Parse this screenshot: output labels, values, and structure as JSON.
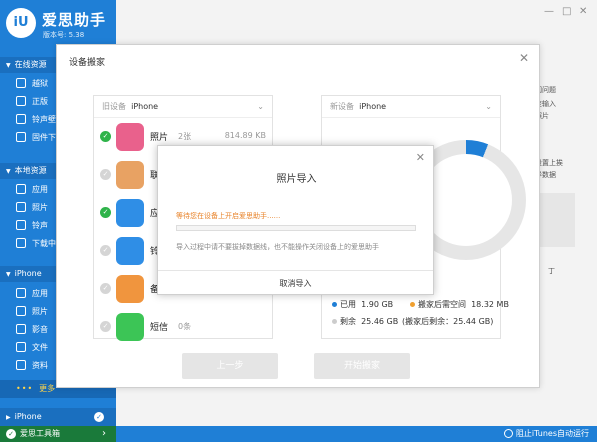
{
  "app": {
    "logo_text": "iU",
    "title": "爱思助手",
    "version": "版本号: 5.38"
  },
  "sidebar": {
    "online_header": "在线资源",
    "online_items": [
      "越狱",
      "正版",
      "铃声壁",
      "固件下"
    ],
    "local_header": "本地资源",
    "local_items": [
      "应用",
      "照片",
      "铃声",
      "下载中"
    ],
    "iphone_header": "iPhone",
    "iphone_items": [
      "应用",
      "照片",
      "影音",
      "文件",
      "资料"
    ],
    "more_label": "更多",
    "device2_label": "iPhone",
    "toolbox_label": "爱思工具箱"
  },
  "bottom_bar": {
    "itunes_label": "阻止iTunes自动运行"
  },
  "peek": {
    "t1": "闪问题",
    "t2": "变输入",
    "t3": "照片",
    "t4": "设置上挨",
    "t5": "导数据",
    "t6": "丁"
  },
  "dialog": {
    "title": "设备搬家",
    "old_device": {
      "prefix": "旧设备",
      "name": "iPhone"
    },
    "new_device": {
      "prefix": "新设备",
      "name": "iPhone"
    },
    "rows": [
      {
        "name": "照片",
        "count": "2张",
        "size": "814.89 KB",
        "checked": true,
        "color": "#e9618c"
      },
      {
        "name": "联",
        "count": "",
        "size": "",
        "checked": false,
        "color": "#e8a263"
      },
      {
        "name": "应",
        "count": "",
        "size": "",
        "checked": true,
        "color": "#2f8ee6"
      },
      {
        "name": "铃",
        "count": "",
        "size": "",
        "checked": false,
        "color": "#2f8ee6"
      },
      {
        "name": "备",
        "count": "",
        "size": "",
        "checked": false,
        "color": "#f0953e"
      },
      {
        "name": "短信",
        "count": "0条",
        "size": "",
        "checked": false,
        "color": "#3cc556"
      }
    ],
    "legend": {
      "used_label": "已用",
      "used_value": "1.90 GB",
      "after_label": "搬家后需空间",
      "after_value": "18.32 MB",
      "free_label": "剩余",
      "free_value": "25.46 GB",
      "after_free": "(搬家后剩余：25.44 GB)"
    },
    "prev_button": "上一步",
    "start_button": "开始搬家"
  },
  "progress_dialog": {
    "title": "照片导入",
    "warning": "等待您在设备上开启爱思助手......",
    "progress": 0,
    "tip": "导入过程中请不要拔掉数据线，也不能操作关闭设备上的爱思助手",
    "cancel": "取消导入"
  },
  "colors": {
    "brand": "#1f7fd6",
    "green": "#2fb34a",
    "warn": "#e8832a"
  }
}
